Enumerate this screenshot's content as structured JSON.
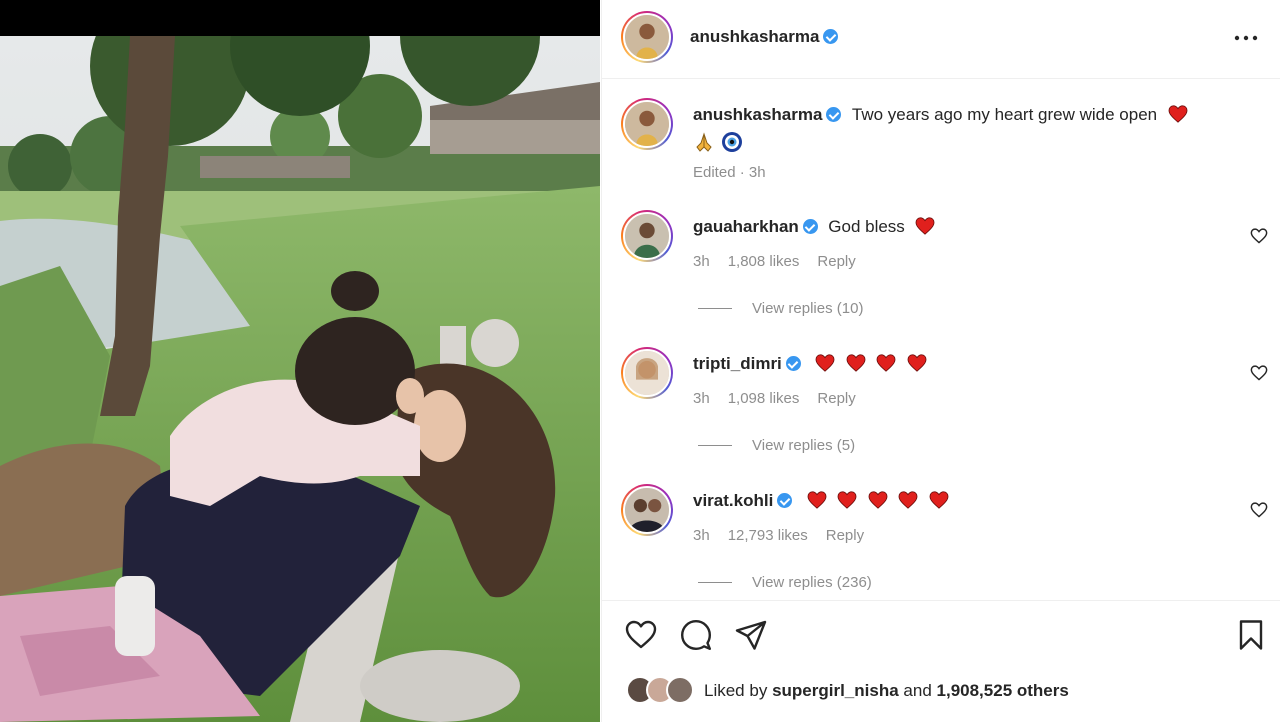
{
  "post": {
    "author": "anushkasharma",
    "author_verified": true,
    "more_options_icon": "more-horizontal-icon"
  },
  "caption": {
    "username": "anushkasharma",
    "text": "Two years ago my heart grew wide open",
    "emojis": [
      "red-heart-emoji",
      "folded-hands-emoji",
      "nazar-amulet-emoji"
    ],
    "timestamp": "Edited · 3h"
  },
  "comments": [
    {
      "username": "gauaharkhan",
      "text": "God bless",
      "hearts": 1,
      "time": "3h",
      "likes": "1,808 likes",
      "reply": "Reply",
      "view_replies": "View replies (10)"
    },
    {
      "username": "tripti_dimri",
      "text": "",
      "hearts": 4,
      "time": "3h",
      "likes": "1,098 likes",
      "reply": "Reply",
      "view_replies": "View replies (5)"
    },
    {
      "username": "virat.kohli",
      "text": "",
      "hearts": 5,
      "time": "3h",
      "likes": "12,793 likes",
      "reply": "Reply",
      "view_replies": "View replies (236)"
    }
  ],
  "actions": {
    "like_icon": "heart-outline-icon",
    "comment_icon": "comment-bubble-icon",
    "share_icon": "paper-plane-icon",
    "save_icon": "bookmark-icon"
  },
  "likes": {
    "prefix": "Liked by",
    "user": "supergirl_nisha",
    "connector": "and",
    "others": "1,908,525 others"
  },
  "colors": {
    "heart_emoji": "#e0201d",
    "verified_badge": "#3897f0",
    "meta_text": "#8e8e8e",
    "primary_text": "#262626"
  }
}
